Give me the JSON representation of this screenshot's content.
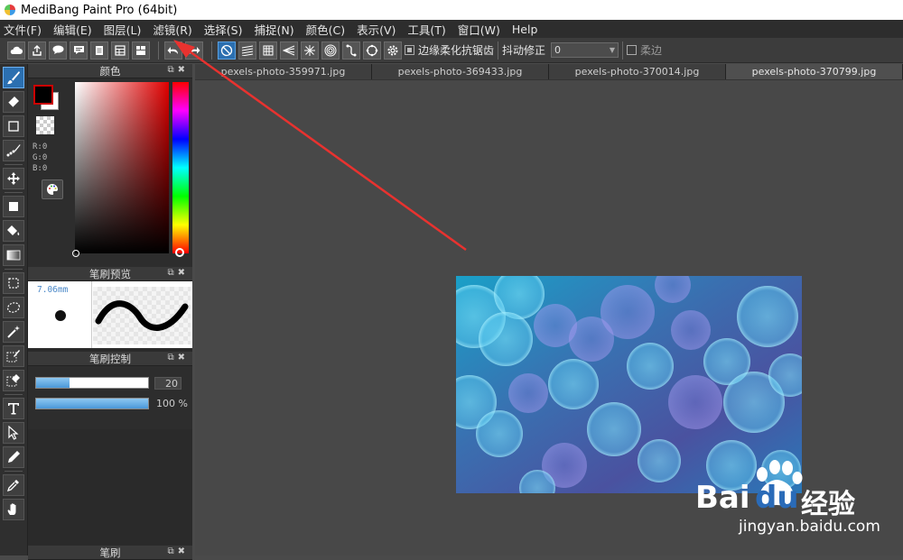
{
  "window": {
    "title": "MediBang Paint Pro (64bit)"
  },
  "menu": [
    "文件(F)",
    "编辑(E)",
    "图层(L)",
    "滤镜(R)",
    "选择(S)",
    "捕捉(N)",
    "颜色(C)",
    "表示(V)",
    "工具(T)",
    "窗口(W)",
    "Help"
  ],
  "toolbar": {
    "antialias_label": "边缘柔化抗锯齿",
    "antialias_checked": true,
    "stabilizer_label": "抖动修正",
    "stabilizer_value": "0",
    "soft_edge_label": "柔边",
    "soft_edge_checked": false
  },
  "panels": {
    "color": {
      "title": "颜色",
      "r": "R:0",
      "g": "G:0",
      "b": "B:0",
      "foreground": "#000000",
      "background": "#ffffff"
    },
    "brush_preview": {
      "title": "笔刷预览",
      "size": "7.06mm"
    },
    "brush_control": {
      "title": "笔刷控制",
      "size_value": "20",
      "opacity_value": "100 %",
      "size_fraction": 0.3,
      "opacity_fraction": 1.0
    },
    "brush_list": {
      "title": "笔刷"
    }
  },
  "tabs": [
    "pexels-photo-359971.jpg",
    "pexels-photo-369433.jpg",
    "pexels-photo-370014.jpg",
    "pexels-photo-370799.jpg"
  ],
  "active_tab": 3,
  "watermark": {
    "brand": "Bai",
    "brand2": "du",
    "brand_cn": "经验",
    "url": "jingyan.baidu.com"
  },
  "colors": {
    "accent": "#2b6fb0",
    "annotation_arrow": "#e8322f"
  }
}
